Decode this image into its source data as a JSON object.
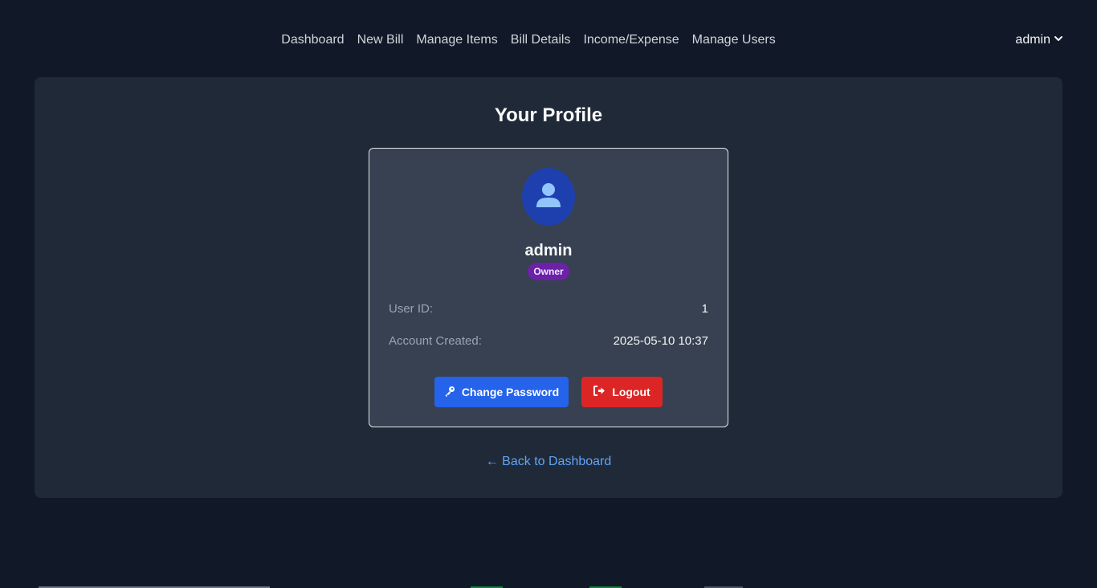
{
  "nav": {
    "links": [
      "Dashboard",
      "New Bill",
      "Manage Items",
      "Bill Details",
      "Income/Expense",
      "Manage Users"
    ],
    "user": "admin",
    "user_icon": "chevron-down-icon"
  },
  "page": {
    "title": "Your Profile"
  },
  "profile": {
    "name": "admin",
    "role": "Owner",
    "avatar_icon": "user-icon",
    "fields": [
      {
        "label": "User ID:",
        "value": "1"
      },
      {
        "label": "Account Created:",
        "value": "2025-05-10 10:37"
      }
    ]
  },
  "actions": {
    "change_password": "Change Password",
    "change_password_icon": "key-icon",
    "logout": "Logout",
    "logout_icon": "sign-out-icon",
    "back": "← Back to Dashboard"
  },
  "colors": {
    "background": "#111827",
    "panel": "#1f2937",
    "card": "#374151",
    "primary": "#2563eb",
    "danger": "#dc2626",
    "badge": "#6b21a8",
    "link": "#60a5fa"
  }
}
